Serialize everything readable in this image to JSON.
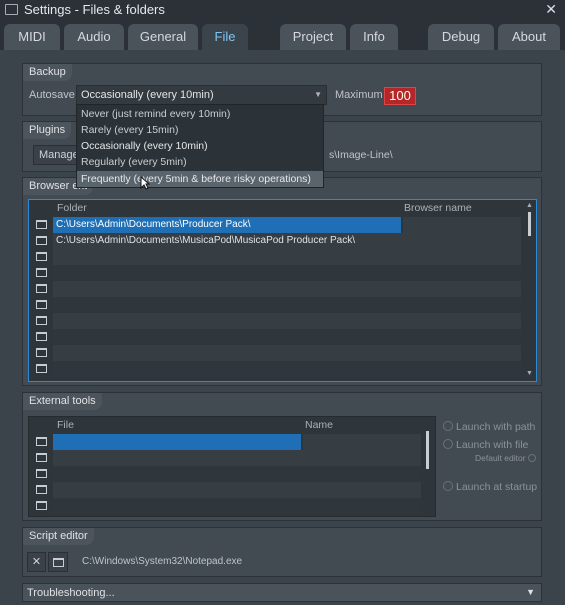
{
  "window": {
    "title": "Settings - Files & folders",
    "close": "✕"
  },
  "tabs": [
    {
      "label": "MIDI"
    },
    {
      "label": "Audio"
    },
    {
      "label": "General"
    },
    {
      "label": "File"
    },
    {
      "label": "Project"
    },
    {
      "label": "Info"
    },
    {
      "label": "Debug"
    },
    {
      "label": "About"
    }
  ],
  "backup": {
    "header": "Backup",
    "autosave_label": "Autosave",
    "autosave_value": "Occasionally (every 10min)",
    "maximum_label": "Maximum",
    "maximum_value": "100",
    "options": [
      "Never (just remind every 10min)",
      "Rarely (every 15min)",
      "Occasionally (every 10min)",
      "Regularly (every 5min)",
      "Frequently (every 5min & before risky operations)"
    ]
  },
  "plugins": {
    "header": "Plugins",
    "manage_label": "Manage",
    "path_tail": "s\\Image-Line\\"
  },
  "browser": {
    "header": "Browser ext",
    "col_folder": "Folder",
    "col_name": "Browser name",
    "rows": [
      "C:\\Users\\Admin\\Documents\\Producer Pack\\",
      "C:\\Users\\Admin\\Documents\\MusicaPod\\MusicaPod Producer Pack\\"
    ]
  },
  "external": {
    "header": "External tools",
    "col_file": "File",
    "col_name": "Name",
    "launch_path": "Launch with path",
    "launch_file": "Launch with file",
    "default_editor": "Default editor",
    "launch_startup": "Launch at startup"
  },
  "script": {
    "header": "Script editor",
    "path": "C:\\Windows\\System32\\Notepad.exe"
  },
  "troubleshooting": {
    "label": "Troubleshooting..."
  }
}
